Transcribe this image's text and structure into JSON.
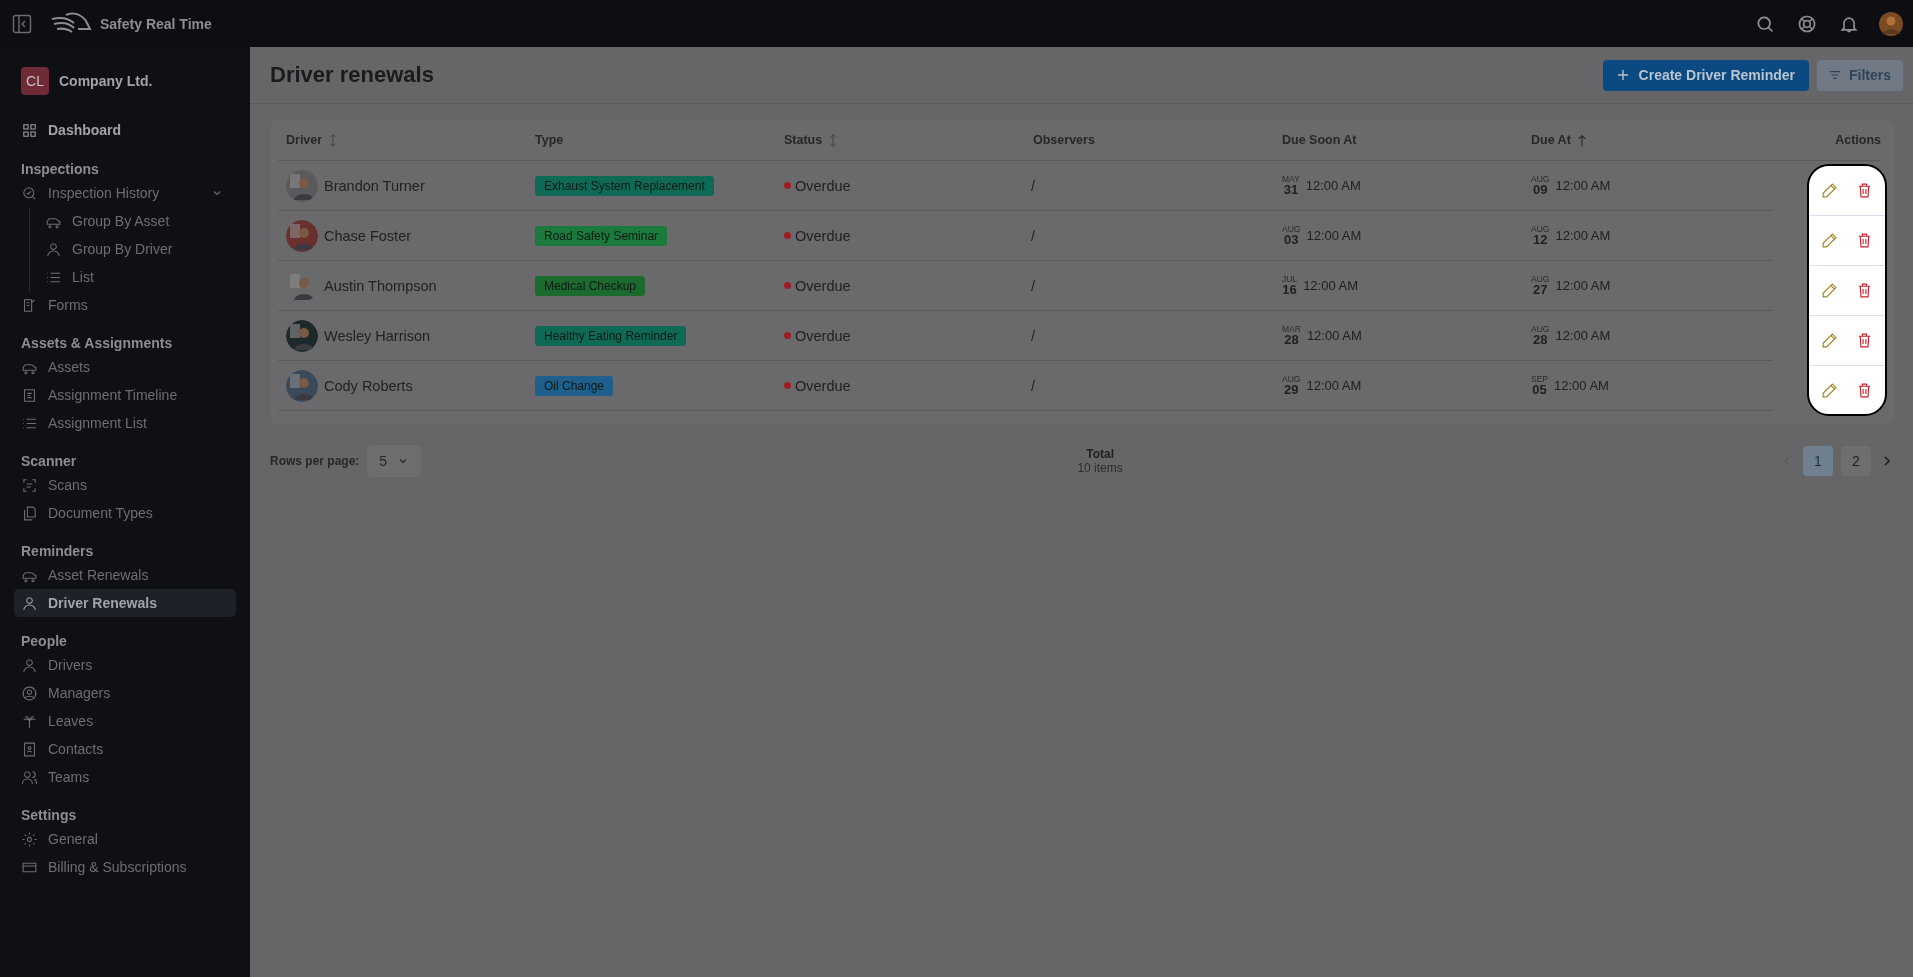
{
  "app": {
    "title": "Safety Real Time"
  },
  "company": {
    "initials": "CL",
    "name": "Company Ltd."
  },
  "sidebar": {
    "sections": [
      {
        "items": [
          {
            "label": "Dashboard",
            "selected": false
          }
        ]
      },
      {
        "heading": "Inspections",
        "items": [
          {
            "label": "Inspection History",
            "selected": false,
            "expanded": true,
            "children": [
              {
                "label": "Group By Asset",
                "selected": false
              },
              {
                "label": "Group By Driver",
                "selected": false
              },
              {
                "label": "List",
                "selected": false
              }
            ]
          },
          {
            "label": "Forms",
            "selected": false
          }
        ]
      },
      {
        "heading": "Assets & Assignments",
        "items": [
          {
            "label": "Assets",
            "selected": false
          },
          {
            "label": "Assignment Timeline",
            "selected": false
          },
          {
            "label": "Assignment List",
            "selected": false
          }
        ]
      },
      {
        "heading": "Scanner",
        "items": [
          {
            "label": "Scans",
            "selected": false
          },
          {
            "label": "Document Types",
            "selected": false
          }
        ]
      },
      {
        "heading": "Reminders",
        "items": [
          {
            "label": "Asset Renewals",
            "selected": false
          },
          {
            "label": "Driver Renewals",
            "selected": true
          }
        ]
      },
      {
        "heading": "People",
        "items": [
          {
            "label": "Drivers",
            "selected": false
          },
          {
            "label": "Managers",
            "selected": false
          },
          {
            "label": "Leaves",
            "selected": false
          },
          {
            "label": "Contacts",
            "selected": false
          },
          {
            "label": "Teams",
            "selected": false
          }
        ]
      },
      {
        "heading": "Settings",
        "items": [
          {
            "label": "General",
            "selected": false
          },
          {
            "label": "Billing & Subscriptions",
            "selected": false
          }
        ]
      }
    ]
  },
  "page": {
    "title": "Driver renewals",
    "create_button": "Create Driver Reminder",
    "filters_button": "Filters"
  },
  "table": {
    "columns": [
      {
        "label": "Driver",
        "sortable": true
      },
      {
        "label": "Type"
      },
      {
        "label": "Status",
        "sortable": true
      },
      {
        "label": "Observers"
      },
      {
        "label": "Due Soon At"
      },
      {
        "label": "Due At",
        "sorted": true
      },
      {
        "label": "Actions",
        "highlighted": true
      }
    ],
    "rows": [
      {
        "driver": "Brandon Turner",
        "type": {
          "label": "Exhaust System Replacement",
          "color": "#0f6a55"
        },
        "status": {
          "label": "Overdue",
          "color": "#9e1c22"
        },
        "observers": "/",
        "due_soon": {
          "month": "MAY",
          "day": "31",
          "time": "12:00 AM"
        },
        "due": {
          "month": "AUG",
          "day": "09",
          "time": "12:00 AM"
        }
      },
      {
        "driver": "Chase Foster",
        "type": {
          "label": "Road Safety Seminar",
          "color": "#1a7a3c"
        },
        "status": {
          "label": "Overdue",
          "color": "#9e1c22"
        },
        "observers": "/",
        "due_soon": {
          "month": "AUG",
          "day": "03",
          "time": "12:00 AM"
        },
        "due": {
          "month": "AUG",
          "day": "12",
          "time": "12:00 AM"
        }
      },
      {
        "driver": "Austin Thompson",
        "type": {
          "label": "Medical Checkup",
          "color": "#1b6a2e"
        },
        "status": {
          "label": "Overdue",
          "color": "#9e1c22"
        },
        "observers": "/",
        "due_soon": {
          "month": "JUL",
          "day": "16",
          "time": "12:00 AM"
        },
        "due": {
          "month": "AUG",
          "day": "27",
          "time": "12:00 AM"
        }
      },
      {
        "driver": "Wesley Harrison",
        "type": {
          "label": "Healthy Eating Reminder",
          "color": "#0f6a55"
        },
        "status": {
          "label": "Overdue",
          "color": "#9e1c22"
        },
        "observers": "/",
        "due_soon": {
          "month": "MAR",
          "day": "28",
          "time": "12:00 AM"
        },
        "due": {
          "month": "AUG",
          "day": "28",
          "time": "12:00 AM"
        }
      },
      {
        "driver": "Cody Roberts",
        "type": {
          "label": "Oil Change",
          "color": "#1f5f8e"
        },
        "status": {
          "label": "Overdue",
          "color": "#9e1c22"
        },
        "observers": "/",
        "due_soon": {
          "month": "AUG",
          "day": "29",
          "time": "12:00 AM"
        },
        "due": {
          "month": "SEP",
          "day": "05",
          "time": "12:00 AM"
        }
      }
    ]
  },
  "pagination": {
    "rows_label": "Rows per page:",
    "rows_value": "5",
    "total_label": "Total",
    "total_value": "10 items",
    "pages": [
      {
        "label": "1",
        "selected": true
      },
      {
        "label": "2",
        "selected": false
      }
    ]
  }
}
